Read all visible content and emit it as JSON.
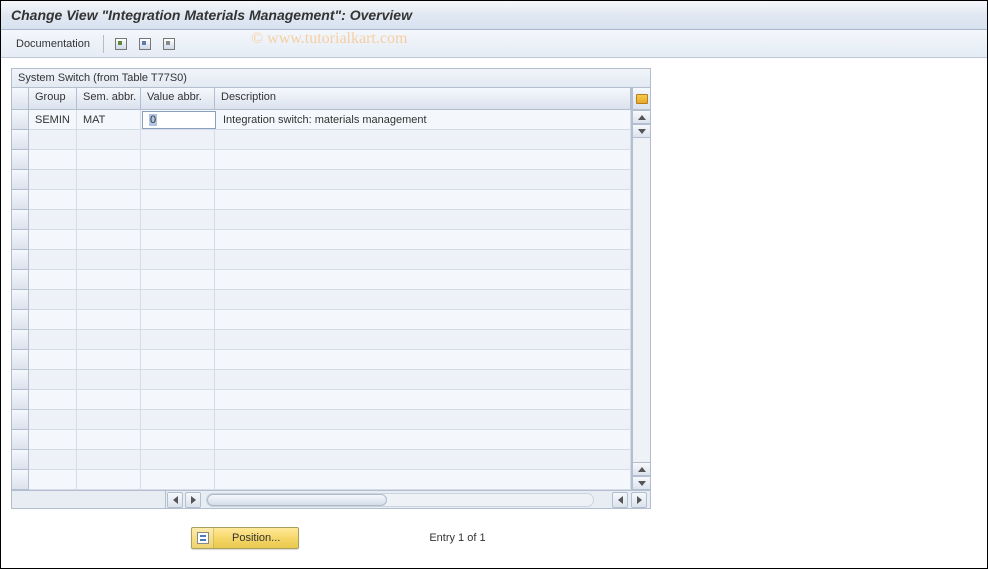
{
  "title": "Change View \"Integration Materials Management\": Overview",
  "toolbar": {
    "documentation_label": "Documentation"
  },
  "watermark": "© www.tutorialkart.com",
  "panel": {
    "title": "System Switch (from Table T77S0)"
  },
  "columns": {
    "group": "Group",
    "sem_abbr": "Sem. abbr.",
    "val_abbr": "Value abbr.",
    "description": "Description"
  },
  "rows": [
    {
      "group": "SEMIN",
      "sem_abbr": "MAT",
      "val_abbr": "0",
      "description": "Integration switch: materials management"
    }
  ],
  "footer": {
    "position_label": "Position...",
    "entry_text": "Entry 1 of 1"
  }
}
